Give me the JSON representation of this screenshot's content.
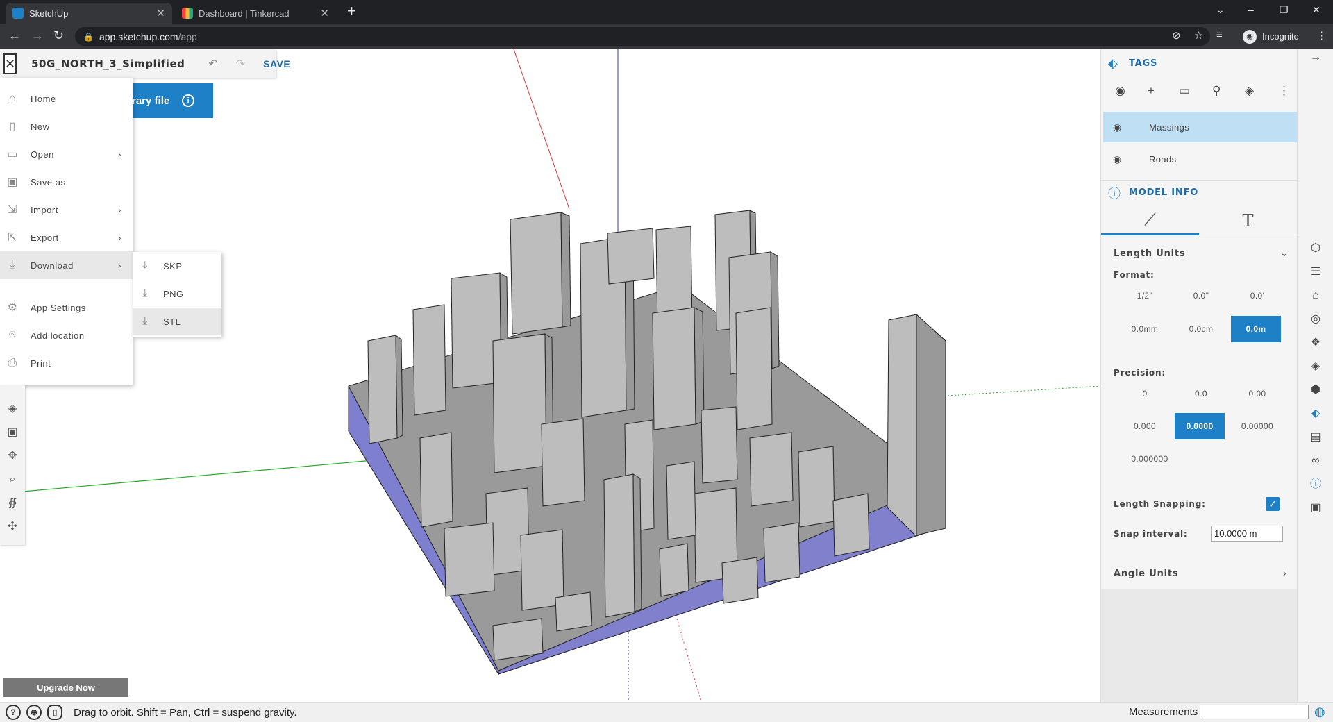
{
  "browser": {
    "tabs": [
      {
        "label": "SketchUp",
        "active": true
      },
      {
        "label": "Dashboard | Tinkercad",
        "active": false
      }
    ],
    "url_host": "app.sketchup.com",
    "url_path": "/app",
    "incognito_label": "Incognito"
  },
  "titlebar": {
    "model_name": "50G_NORTH_3_Simplified",
    "save_label": "SAVE"
  },
  "banner_button": {
    "label": "rary file"
  },
  "file_menu": {
    "items": [
      {
        "label": "Home",
        "icon": "home-icon",
        "has_submenu": false
      },
      {
        "label": "New",
        "icon": "new-file-icon",
        "has_submenu": false
      },
      {
        "label": "Open",
        "icon": "folder-icon",
        "has_submenu": true
      },
      {
        "label": "Save as",
        "icon": "save-as-icon",
        "has_submenu": false
      },
      {
        "label": "Import",
        "icon": "import-icon",
        "has_submenu": true
      },
      {
        "label": "Export",
        "icon": "export-icon",
        "has_submenu": true
      },
      {
        "label": "Download",
        "icon": "download-icon",
        "has_submenu": true
      },
      {
        "label": "App Settings",
        "icon": "gear-icon",
        "has_submenu": false
      },
      {
        "label": "Add location",
        "icon": "location-pin-icon",
        "has_submenu": false
      },
      {
        "label": "Print",
        "icon": "printer-icon",
        "has_submenu": false
      }
    ],
    "download_submenu": [
      "SKP",
      "PNG",
      "STL"
    ]
  },
  "upgrade_label": "Upgrade Now",
  "status": {
    "hint": "Drag to orbit. Shift = Pan, Ctrl = suspend gravity.",
    "measurements_label": "Measurements",
    "measurements_value": ""
  },
  "tags_panel": {
    "title": "TAGS",
    "tags": [
      {
        "name": "Massings",
        "selected": true
      },
      {
        "name": "Roads",
        "selected": false
      }
    ]
  },
  "model_info": {
    "title": "MODEL INFO",
    "length_units_label": "Length Units",
    "format_label": "Format:",
    "format_options": [
      "1/2\"",
      "0.0\"",
      "0.0'",
      "0.0mm",
      "0.0cm",
      "0.0m"
    ],
    "format_selected": "0.0m",
    "precision_label": "Precision:",
    "precision_options": [
      "0",
      "0.0",
      "0.00",
      "0.000",
      "0.0000",
      "0.00000",
      "0.000000"
    ],
    "precision_selected": "0.0000",
    "length_snapping_label": "Length Snapping:",
    "length_snapping": true,
    "snap_interval_label": "Snap interval:",
    "snap_interval_value": "10.0000 m",
    "angle_units_label": "Angle Units"
  },
  "colors": {
    "accent": "#1e80c6",
    "base_slab": "#7f7fd0",
    "building": "#b8b8b8"
  }
}
